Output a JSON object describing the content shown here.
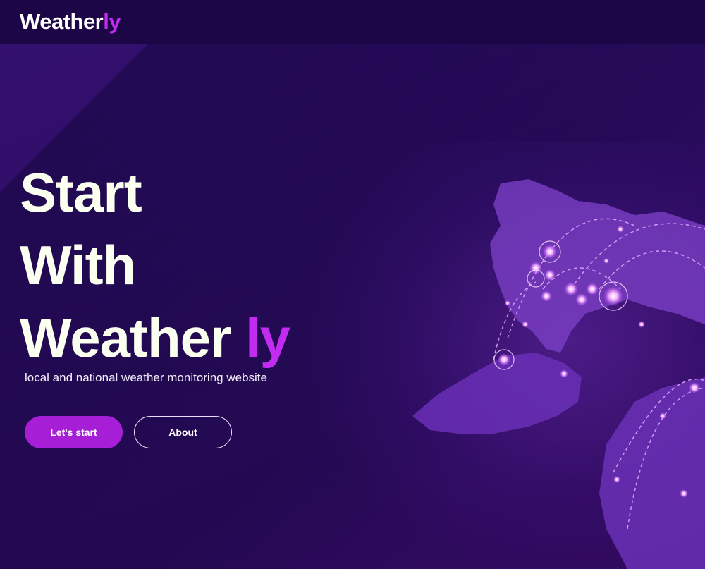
{
  "header": {
    "logo_main": "Weather",
    "logo_accent": "ly"
  },
  "hero": {
    "line1": "Start",
    "line2": "With",
    "line3_main": "Weather ",
    "line3_accent": "ly",
    "subtitle": "local and national weather monitoring website",
    "primary_button": "Let's start",
    "secondary_button": "About"
  },
  "colors": {
    "accent": "#c22cf0",
    "button_primary": "#a61fd6",
    "topbar": "#1d0645",
    "background": "#2a0a5c"
  },
  "icons": [
    "world-map-illustration"
  ]
}
